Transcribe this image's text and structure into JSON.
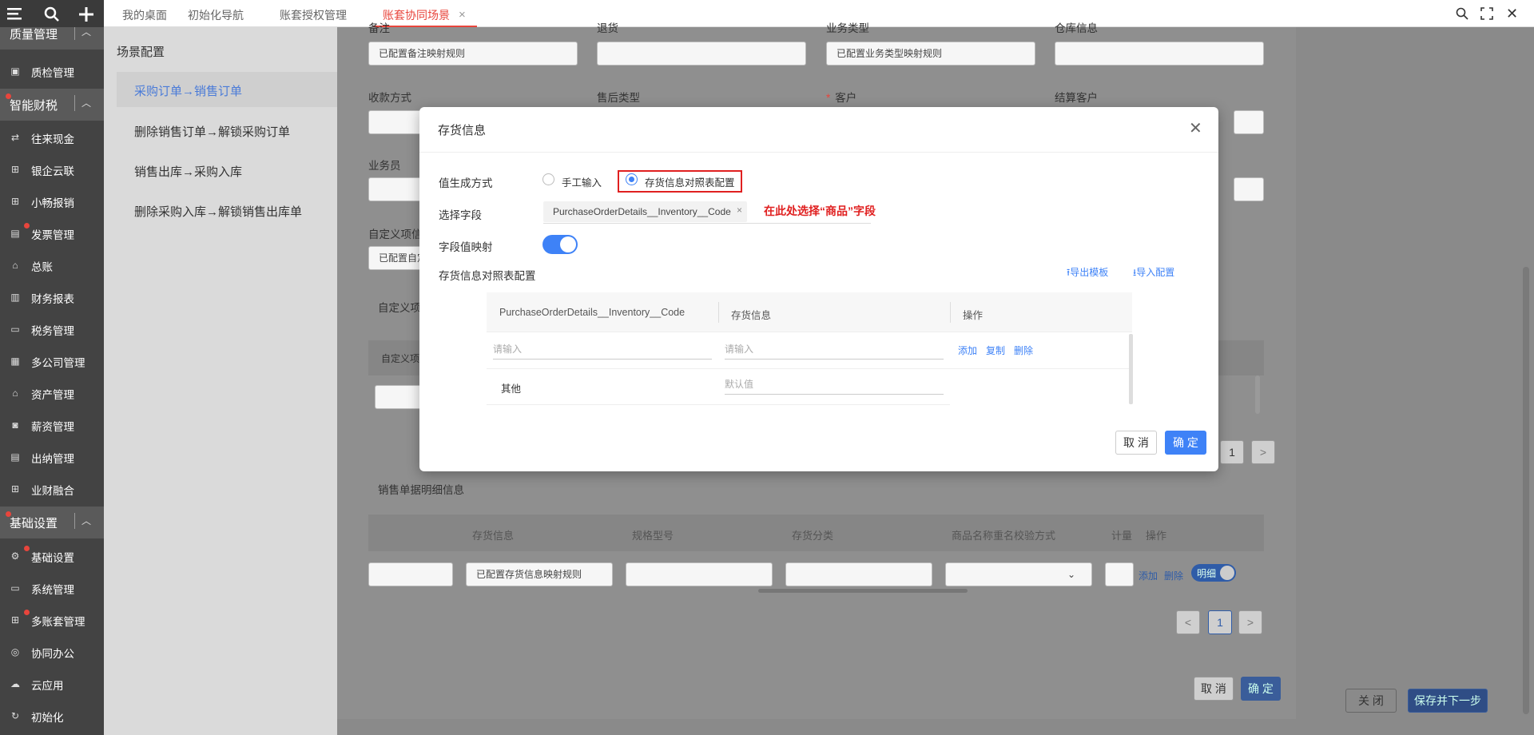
{
  "topbar": {
    "tabs": [
      {
        "label": "我的桌面"
      },
      {
        "label": "初始化导航"
      },
      {
        "label": "账套授权管理"
      },
      {
        "label": "账套协同场景"
      }
    ]
  },
  "sidebar": {
    "groups": {
      "quality": "质量管理",
      "finance": "智能财税",
      "basic": "基础设置"
    },
    "items": [
      "质检管理",
      "往来现金",
      "银企云联",
      "小畅报销",
      "发票管理",
      "总账",
      "财务报表",
      "税务管理",
      "多公司管理",
      "资产管理",
      "薪资管理",
      "出纳管理",
      "业财融合",
      "基础设置",
      "系统管理",
      "多账套管理",
      "协同办公",
      "云应用",
      "初始化"
    ]
  },
  "left_panel": {
    "title": "场景配置",
    "items": [
      "采购订单→销售订单",
      "删除销售订单→解锁采购订单",
      "销售出库→采购入库",
      "删除采购入库→解锁销售出库单"
    ]
  },
  "form": {
    "labels_row1": [
      "备注",
      "退货",
      "业务类型",
      "仓库信息"
    ],
    "values_row1": [
      "已配置备注映射规则",
      "",
      "已配置业务类型映射规则",
      ""
    ],
    "labels_row2": [
      "收款方式",
      "售后类型",
      "客户",
      "结算客户"
    ],
    "required_mark": "*",
    "label_salesman": "业务员",
    "label_custom": "自定义项信",
    "value_custom": "已配置自定",
    "custom_section": "自定义项",
    "custom_col": "自定义项",
    "detail_title": "销售单据明细信息",
    "detail_headers": [
      "存货信息",
      "规格型号",
      "存货分类",
      "商品名称重名校验方式",
      "计量",
      "操作"
    ],
    "detail_value": "已配置存货信息映射规则",
    "detail_actions": [
      "添加",
      "删除"
    ],
    "toggle_text": "明细",
    "page_num": "1",
    "upper_page_num": "1",
    "prev": "<",
    "next": ">",
    "cancel": "取 消",
    "ok": "确 定"
  },
  "right": {
    "close": "关 闭",
    "save_next": "保存并下一步"
  },
  "dialog": {
    "title": "存货信息",
    "gen_label": "值生成方式",
    "radio_manual": "手工输入",
    "radio_table": "存货信息对照表配置",
    "select_label": "选择字段",
    "select_value": "PurchaseOrderDetails__Inventory__Code",
    "annotation": "在此处选择“商品”字段",
    "mapping_label": "字段值映射",
    "table_title": "存货信息对照表配置",
    "export": "导出模板",
    "import": "导入配置",
    "columns": [
      "PurchaseOrderDetails__Inventory__Code",
      "存货信息",
      "操作"
    ],
    "placeholder": "请输入",
    "row_actions": [
      "添加",
      "复制",
      "删除"
    ],
    "other": "其他",
    "default_placeholder": "默认值",
    "cancel": "取 消",
    "ok": "确 定"
  },
  "colors": {
    "accent": "#3e82f7",
    "tab_active": "#e8453c",
    "sidebar": "#434343"
  }
}
